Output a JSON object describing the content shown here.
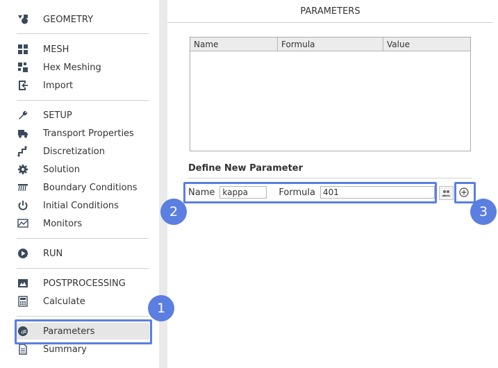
{
  "sidebar": {
    "groups": [
      {
        "items": [
          {
            "label": "GEOMETRY",
            "icon": "geometry-icon"
          }
        ]
      },
      {
        "items": [
          {
            "label": "MESH",
            "icon": "mesh-icon"
          },
          {
            "label": "Hex Meshing",
            "icon": "hex-meshing-icon"
          },
          {
            "label": "Import",
            "icon": "import-icon"
          }
        ]
      },
      {
        "items": [
          {
            "label": "SETUP",
            "icon": "wrench-icon"
          },
          {
            "label": "Transport Properties",
            "icon": "truck-icon"
          },
          {
            "label": "Discretization",
            "icon": "discretization-icon"
          },
          {
            "label": "Solution",
            "icon": "gear-icon"
          },
          {
            "label": "Boundary Conditions",
            "icon": "boundary-conditions-icon"
          },
          {
            "label": "Initial Conditions",
            "icon": "power-icon"
          },
          {
            "label": "Monitors",
            "icon": "monitor-chart-icon"
          }
        ]
      },
      {
        "items": [
          {
            "label": "RUN",
            "icon": "play-icon"
          }
        ]
      },
      {
        "items": [
          {
            "label": "POSTPROCESSING",
            "icon": "image-icon"
          },
          {
            "label": "Calculate",
            "icon": "calculator-icon"
          }
        ]
      },
      {
        "items": [
          {
            "label": "Parameters",
            "icon": "parameters-icon",
            "active": true
          },
          {
            "label": "Summary",
            "icon": "document-icon"
          }
        ]
      }
    ]
  },
  "main": {
    "title": "PARAMETERS",
    "table": {
      "columns": [
        "Name",
        "Formula",
        "Value"
      ],
      "rows": []
    },
    "define_title": "Define New Parameter",
    "form": {
      "name_label": "Name",
      "name_value": "kappa",
      "formula_label": "Formula",
      "formula_value": "401"
    }
  },
  "callouts": [
    "1",
    "2",
    "3"
  ],
  "colors": {
    "highlight": "#5b7fe0",
    "icon": "#3b4a5a"
  }
}
